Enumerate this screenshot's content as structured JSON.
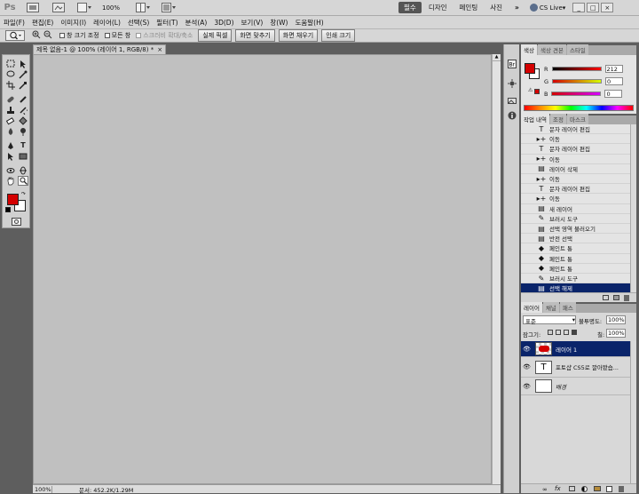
{
  "app_bar": {
    "logo": "Ps",
    "zoom": "100%",
    "workspaces": [
      "필수",
      "디자인",
      "페인팅",
      "사진"
    ],
    "more": "»",
    "cs_live": "CS Live▾",
    "window_buttons": [
      "_",
      "□",
      "×"
    ]
  },
  "menu": [
    "파일(F)",
    "편집(E)",
    "이미지(I)",
    "레이어(L)",
    "선택(S)",
    "필터(T)",
    "분석(A)",
    "3D(D)",
    "보기(V)",
    "창(W)",
    "도움말(H)"
  ],
  "options": {
    "resize_windows": "창 크기 조정",
    "all_windows": "모든 창",
    "scrubby_zoom": "스크러비 확대/축소",
    "actual_pixels": "실제 픽셀",
    "fit_screen": "화면 맞추기",
    "fill_screen": "화면 채우기",
    "print_size": "인쇄 크기"
  },
  "document": {
    "tab_title": "제목 없음-1 @ 100% (레이어 1, RGB/8) *",
    "close": "×",
    "status_zoom": "100%",
    "status_doc": "문서: 452.2K/1.29M"
  },
  "colors": {
    "foreground": "#d40000",
    "background": "#ffffff",
    "selection": "#0a246a"
  },
  "color_panel": {
    "tabs": [
      "색상",
      "색상 견본",
      "스타일"
    ],
    "r_label": "R",
    "r_value": "212",
    "g_label": "G",
    "g_value": "0",
    "b_label": "B",
    "b_value": "0"
  },
  "history_panel": {
    "tabs": [
      "작업 내역",
      "조정",
      "마스크"
    ],
    "items": [
      {
        "icon": "T",
        "label": "문자 레이어 편집"
      },
      {
        "icon": "▸+",
        "label": "이동"
      },
      {
        "icon": "T",
        "label": "문자 레이어 편집"
      },
      {
        "icon": "▸+",
        "label": "이동"
      },
      {
        "icon": "▤",
        "label": "레이어 삭제"
      },
      {
        "icon": "▸+",
        "label": "이동"
      },
      {
        "icon": "T",
        "label": "문자 레이어 편집"
      },
      {
        "icon": "▸+",
        "label": "이동"
      },
      {
        "icon": "▤",
        "label": "새 레이어"
      },
      {
        "icon": "✎",
        "label": "브러시 도구"
      },
      {
        "icon": "▤",
        "label": "선택 영역 불러오기"
      },
      {
        "icon": "▤",
        "label": "반전 선택"
      },
      {
        "icon": "◆",
        "label": "페인트 통"
      },
      {
        "icon": "◆",
        "label": "페인트 통"
      },
      {
        "icon": "◆",
        "label": "페인트 통"
      },
      {
        "icon": "✎",
        "label": "브러시 도구"
      },
      {
        "icon": "▤",
        "label": "선택 해제"
      }
    ]
  },
  "layers_panel": {
    "tabs": [
      "레이어",
      "채널",
      "패스"
    ],
    "blend_mode": "표준",
    "opacity_label": "불투명도:",
    "opacity": "100%",
    "lock_label": "잠그기:",
    "fill_label": "칠:",
    "fill": "100%",
    "layers": [
      {
        "name": "레이어 1",
        "thumb": "",
        "selected": true
      },
      {
        "name": "포토샵 CS5로 깔아봤습...",
        "thumb": "T",
        "selected": false
      },
      {
        "name": "배경",
        "thumb": "",
        "selected": false
      }
    ]
  }
}
